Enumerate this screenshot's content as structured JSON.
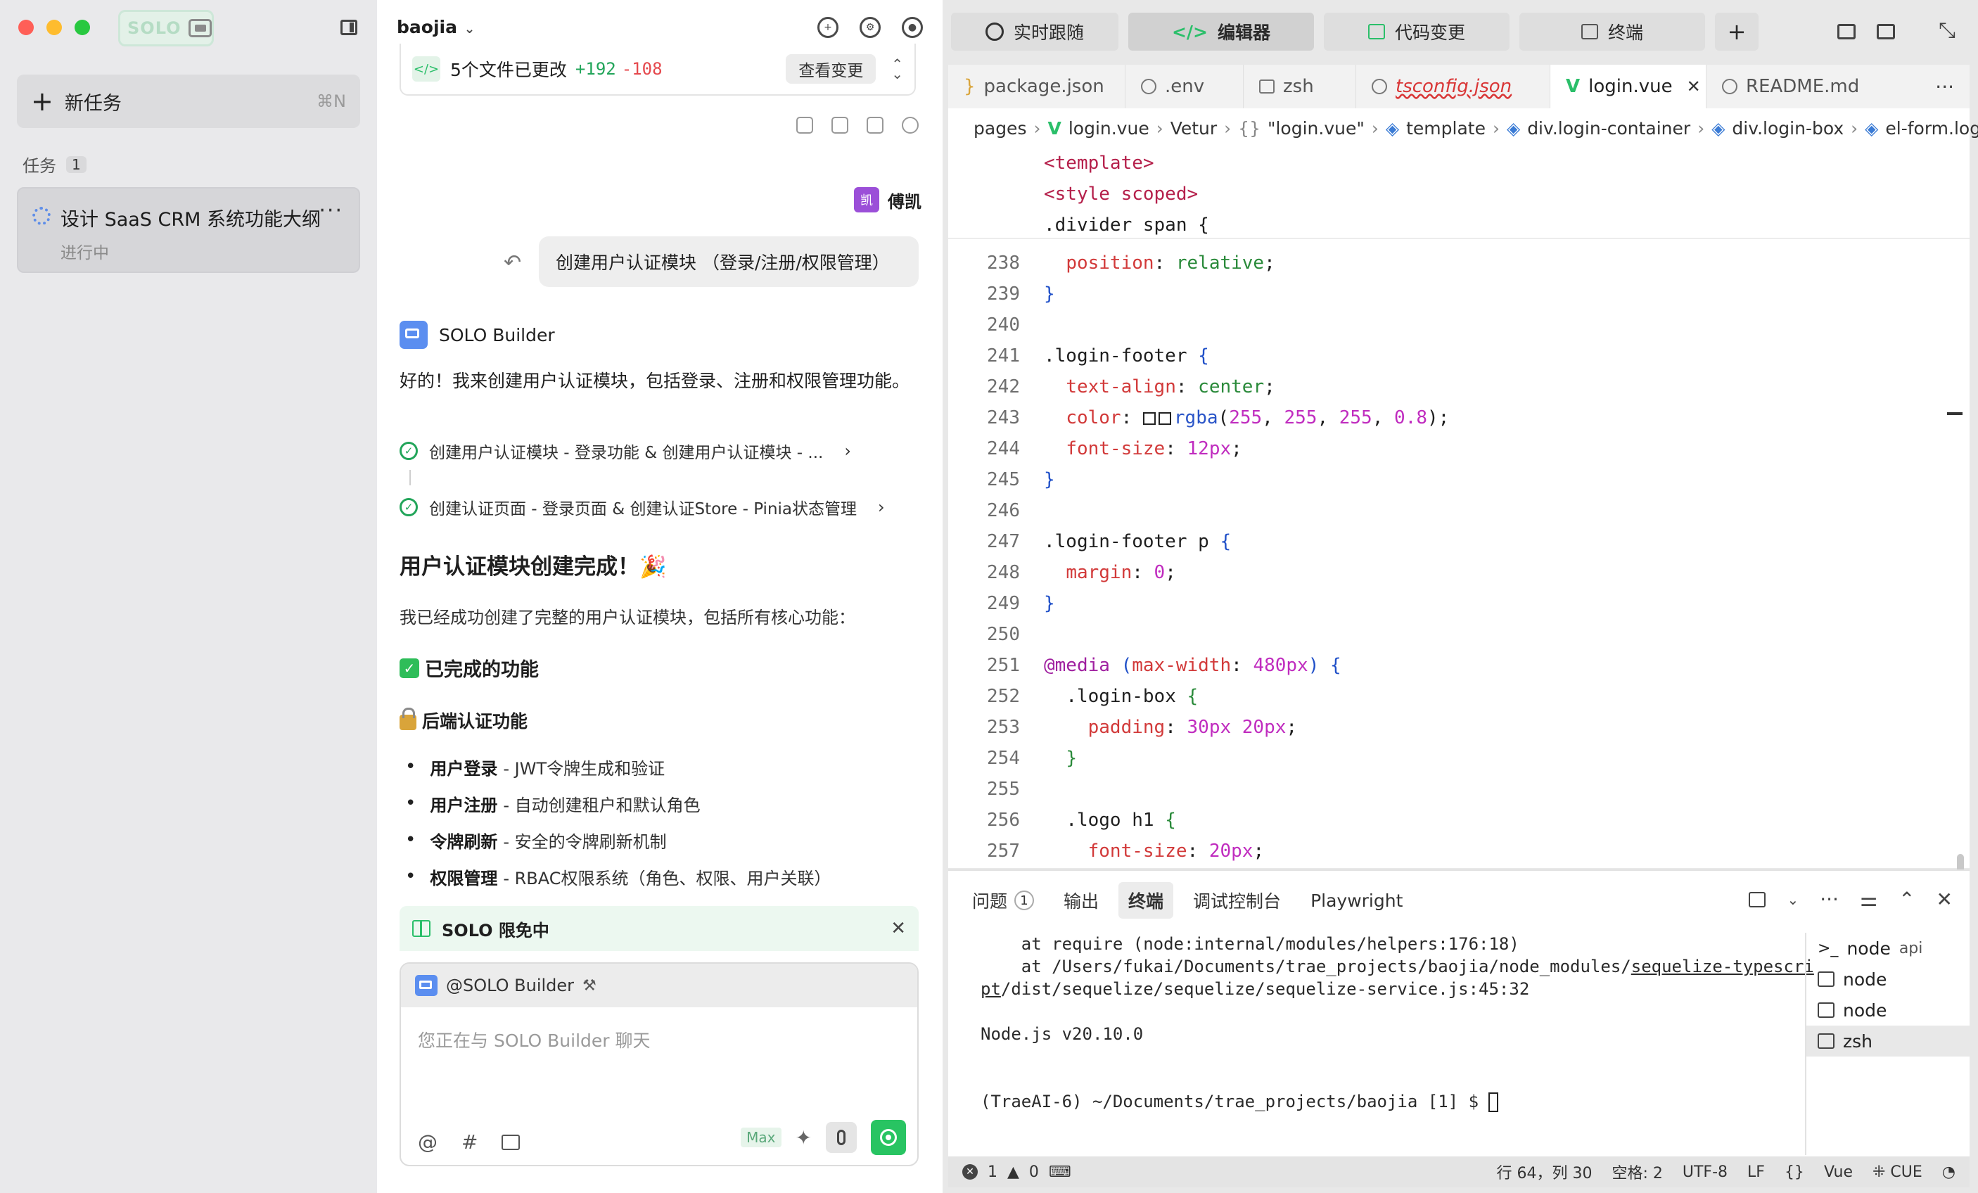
{
  "window": {
    "traffic_colors": [
      "#ff5f57",
      "#febc2e",
      "#28c840"
    ],
    "brand_color": "#28c462",
    "accent_color": "#5b8ef0"
  },
  "sidebar": {
    "solo_label": "SOLO",
    "new_task_label": "新任务",
    "new_task_shortcut": "⌘N",
    "tasks_header": "任务",
    "tasks_count": "1",
    "task": {
      "title": "设计 SaaS CRM 系统功能大纲",
      "status": "进行中",
      "more": "···"
    }
  },
  "chat": {
    "project": "baojia",
    "changes": {
      "label": "5个文件已更改",
      "added": "+192",
      "removed": "-108",
      "view_label": "查看变更"
    },
    "user": {
      "avatar_text": "凯",
      "name": "傅凯",
      "message": "创建用户认证模块 （登录/注册/权限管理）"
    },
    "bot": {
      "name": "SOLO Builder",
      "intro": "好的！我来创建用户认证模块，包括登录、注册和权限管理功能。"
    },
    "steps": [
      "创建用户认证模块 - 登录功能 & 创建用户认证模块 - ...",
      "创建认证页面 - 登录页面 & 创建认证Store - Pinia状态管理"
    ],
    "heading": "用户认证模块创建完成！🎉",
    "paragraph": "我已经成功创建了完整的用户认证模块，包括所有核心功能：",
    "done_heading": "已完成的功能",
    "backend_heading": "后端认证功能",
    "bullets": [
      {
        "bold": "用户登录",
        "text": "- JWT令牌生成和验证"
      },
      {
        "bold": "用户注册",
        "text": "- 自动创建租户和默认角色"
      },
      {
        "bold": "令牌刷新",
        "text": "- 安全的令牌刷新机制"
      },
      {
        "bold": "权限管理",
        "text": "- RBAC权限系统（角色、权限、用户关联）"
      }
    ],
    "promo": "SOLO 限免中",
    "composer": {
      "mention": "@SOLO Builder",
      "placeholder": "您正在与 SOLO Builder 聊天",
      "max_label": "Max"
    }
  },
  "editor": {
    "top_tabs": [
      {
        "label": "实时跟随"
      },
      {
        "label": "编辑器",
        "active": true
      },
      {
        "label": "代码变更"
      },
      {
        "label": "终端"
      }
    ],
    "file_tabs": [
      {
        "label": "package.json"
      },
      {
        "label": ".env"
      },
      {
        "label": "zsh"
      },
      {
        "label": "tsconfig.json",
        "error": true
      },
      {
        "label": "login.vue",
        "active": true
      },
      {
        "label": "README.md"
      }
    ],
    "breadcrumb": [
      "pages",
      "login.vue",
      "Vetur",
      "\"login.vue\"",
      "template",
      "div.login-container",
      "div.login-box",
      "el-form.log"
    ],
    "sticky": [
      "<template>",
      "<style scoped>",
      ".divider span {"
    ],
    "line_numbers": [
      "238",
      "239",
      "240",
      "241",
      "242",
      "243",
      "244",
      "245",
      "246",
      "247",
      "248",
      "249",
      "250",
      "251",
      "252",
      "253",
      "254",
      "255",
      "256",
      "257"
    ],
    "code": {
      "l238_prop": "position",
      "l238_val": "relative",
      "l241_sel": ".login-footer",
      "l242_prop": "text-align",
      "l242_val": "center",
      "l243_prop": "color",
      "l243_fn": "rgba",
      "l243_args": [
        "255",
        "255",
        "255",
        "0.8"
      ],
      "l244_prop": "font-size",
      "l244_val": "12px",
      "l247_sel": ".login-footer p",
      "l248_prop": "margin",
      "l248_val": "0",
      "l251_at": "@media",
      "l251_prop": "max-width",
      "l251_val": "480px",
      "l252_sel": ".login-box",
      "l253_prop": "padding",
      "l253_val": "30px 20px",
      "l256_sel": ".logo h1",
      "l257_prop": "font-size",
      "l257_val": "20px"
    },
    "panel": {
      "tabs": [
        {
          "label": "问题",
          "badge": "1"
        },
        {
          "label": "输出"
        },
        {
          "label": "终端",
          "active": true
        },
        {
          "label": "调试控制台"
        },
        {
          "label": "Playwright"
        }
      ],
      "terminal": {
        "line1": "    at require (node:internal/modules/helpers:176:18)",
        "line2a": "    at /Users/fukai/Documents/trae_projects/baojia/node_modules/",
        "line2b": "sequelize-typescri",
        "line3a": "pt",
        "line3b": "/dist/sequelize/sequelize/sequelize-service.js:45:32",
        "line4": "Node.js v20.10.0",
        "prompt": "(TraeAI-6) ~/Documents/trae_projects/baojia [1] $ "
      },
      "terminals": [
        {
          "label": "node",
          "sub": "api"
        },
        {
          "label": "node",
          "sub": ""
        },
        {
          "label": "node",
          "sub": ""
        },
        {
          "label": "zsh",
          "sub": "",
          "active": true
        }
      ]
    },
    "status": {
      "errors": "1",
      "warnings": "0",
      "position": "行 64，列 30",
      "spaces": "空格: 2",
      "encoding": "UTF-8",
      "eol": "LF",
      "braces": "{}",
      "lang": "Vue",
      "cue": "CUE"
    }
  }
}
